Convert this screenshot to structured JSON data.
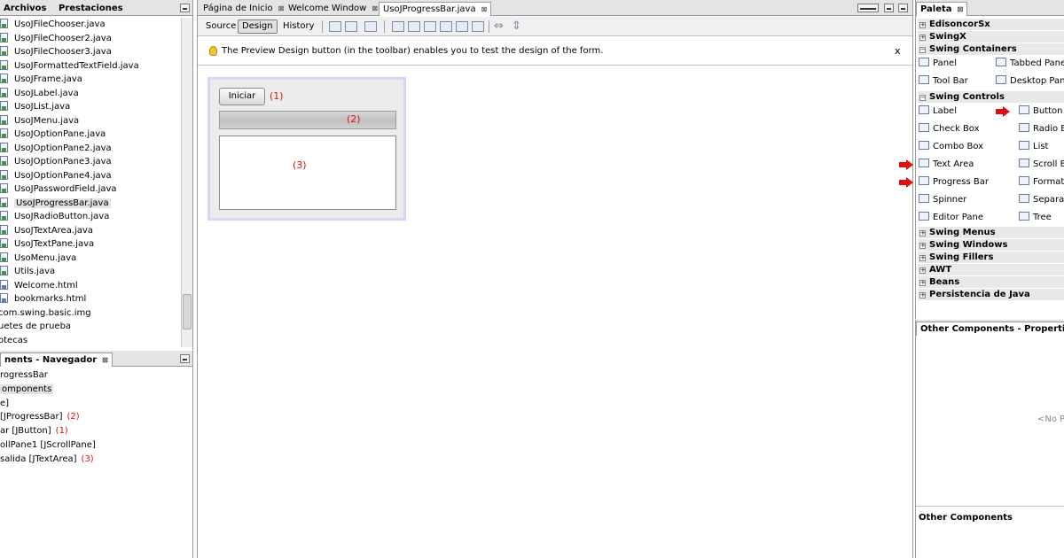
{
  "project_panel": {
    "tabs": [
      "Archivos",
      "Prestaciones"
    ],
    "items": [
      {
        "label": "UsoJFileChooser.java",
        "icon": "java-file-icon"
      },
      {
        "label": "UsoJFileChooser2.java",
        "icon": "java-file-icon"
      },
      {
        "label": "UsoJFileChooser3.java",
        "icon": "java-file-icon"
      },
      {
        "label": "UsoJFormattedTextField.java",
        "icon": "java-file-icon"
      },
      {
        "label": "UsoJFrame.java",
        "icon": "java-file-icon"
      },
      {
        "label": "UsoJLabel.java",
        "icon": "java-file-icon"
      },
      {
        "label": "UsoJList.java",
        "icon": "java-file-icon"
      },
      {
        "label": "UsoJMenu.java",
        "icon": "java-file-icon"
      },
      {
        "label": "UsoJOptionPane.java",
        "icon": "java-file-icon"
      },
      {
        "label": "UsoJOptionPane2.java",
        "icon": "java-file-icon"
      },
      {
        "label": "UsoJOptionPane3.java",
        "icon": "java-file-icon"
      },
      {
        "label": "UsoJOptionPane4.java",
        "icon": "java-file-icon"
      },
      {
        "label": "UsoJPasswordField.java",
        "icon": "java-file-icon"
      },
      {
        "label": "UsoJProgressBar.java",
        "icon": "java-file-icon",
        "selected": true
      },
      {
        "label": "UsoJRadioButton.java",
        "icon": "java-file-icon"
      },
      {
        "label": "UsoJTextArea.java",
        "icon": "java-file-icon"
      },
      {
        "label": "UsoJTextPane.java",
        "icon": "java-file-icon"
      },
      {
        "label": "UsoMenu.java",
        "icon": "java-file-icon"
      },
      {
        "label": "Utils.java",
        "icon": "java-file-icon"
      },
      {
        "label": "Welcome.html",
        "icon": "html-file-icon"
      },
      {
        "label": "bookmarks.html",
        "icon": "html-file-icon"
      },
      {
        "label": "com.swing.basic.img",
        "icon": ""
      },
      {
        "label": "uetes de prueba",
        "icon": ""
      },
      {
        "label": "otecas",
        "icon": ""
      }
    ]
  },
  "navigator": {
    "title": "nents - Navegador",
    "items": [
      {
        "label": "rogressBar",
        "note": ""
      },
      {
        "label": "omponents",
        "note": "",
        "selected": true
      },
      {
        "label": "e]",
        "note": ""
      },
      {
        "label": "[JProgressBar]",
        "note": "(2)"
      },
      {
        "label": "ar [JButton]",
        "note": "(1)"
      },
      {
        "label": "ollPane1 [JScrollPane]",
        "note": ""
      },
      {
        "label": "salida [JTextArea]",
        "note": "(3)"
      }
    ]
  },
  "editor": {
    "tabs": [
      {
        "label": "Página de Inicio"
      },
      {
        "label": "Welcome Window"
      },
      {
        "label": "UsoJProgressBar.java",
        "active": true
      }
    ],
    "views": [
      "Source",
      "Design",
      "History"
    ],
    "active_view": "Design",
    "hint": "The Preview Design button (in the toolbar) enables you to test the design of the form.",
    "hint_close": "x",
    "form": {
      "button_label": "Iniciar",
      "button_note": "(1)",
      "progress_note": "(2)",
      "textarea_note": "(3)"
    }
  },
  "palette": {
    "title": "Paleta",
    "categories": [
      {
        "label": "EdisoncorSx",
        "expanded": false
      },
      {
        "label": "SwingX",
        "expanded": false
      },
      {
        "label": "Swing Containers",
        "expanded": true
      },
      {
        "label": "Swing Controls",
        "expanded": true
      },
      {
        "label": "Swing Menus",
        "expanded": false
      },
      {
        "label": "Swing Windows",
        "expanded": false
      },
      {
        "label": "Swing Fillers",
        "expanded": false
      },
      {
        "label": "AWT",
        "expanded": false
      },
      {
        "label": "Beans",
        "expanded": false
      },
      {
        "label": "Persistencia de Java",
        "expanded": false
      }
    ],
    "containers": [
      "Panel",
      "Tabbed Pane",
      "Tool Bar",
      "Desktop Pane"
    ],
    "controls": [
      {
        "label": "Label",
        "icon": "label-icon",
        "arrow": false
      },
      {
        "label": "Button",
        "icon": "button-icon",
        "arrow": true
      },
      {
        "label": "Check Box",
        "icon": "checkbox-icon",
        "arrow": false
      },
      {
        "label": "Radio Bu",
        "icon": "radio-icon",
        "arrow": false
      },
      {
        "label": "Combo Box",
        "icon": "combobox-icon",
        "arrow": false
      },
      {
        "label": "List",
        "icon": "list-icon",
        "arrow": false
      },
      {
        "label": "Text Area",
        "icon": "textarea-icon",
        "arrow": true
      },
      {
        "label": "Scroll Ba",
        "icon": "scrollbar-icon",
        "arrow": false
      },
      {
        "label": "Progress Bar",
        "icon": "progressbar-icon",
        "arrow": true
      },
      {
        "label": "Formatt",
        "icon": "formatted-icon",
        "arrow": false
      },
      {
        "label": "Spinner",
        "icon": "spinner-icon",
        "arrow": false
      },
      {
        "label": "Separat",
        "icon": "separator-icon",
        "arrow": false
      },
      {
        "label": "Editor Pane",
        "icon": "editorpane-icon",
        "arrow": false
      },
      {
        "label": "Tree",
        "icon": "tree-icon",
        "arrow": false
      }
    ]
  },
  "properties": {
    "title": "Other Components - Properties",
    "empty_text": "<No Pr",
    "footer_title": "Other Components"
  }
}
